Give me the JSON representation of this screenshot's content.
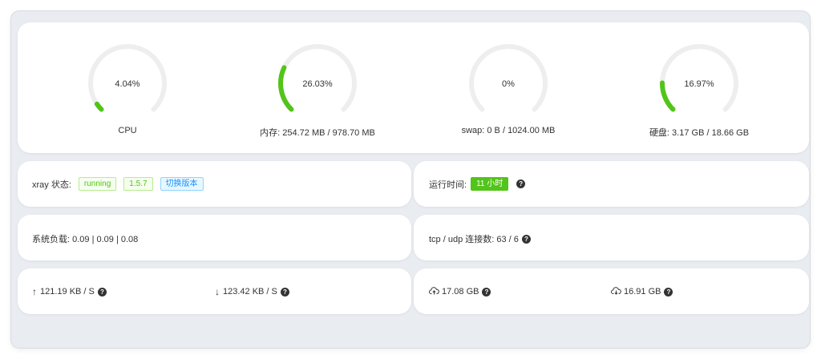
{
  "gauges": [
    {
      "value_text": "4.04%",
      "percent": 4.04,
      "label": "CPU"
    },
    {
      "value_text": "26.03%",
      "percent": 26.03,
      "label": "内存: 254.72 MB / 978.70 MB"
    },
    {
      "value_text": "0%",
      "percent": 0,
      "label": "swap: 0 B / 1024.00 MB"
    },
    {
      "value_text": "16.97%",
      "percent": 16.97,
      "label": "硬盘: 3.17 GB / 18.66 GB"
    }
  ],
  "xray": {
    "label": "xray 状态:",
    "status": "running",
    "version": "1.5.7",
    "switch_label": "切换版本"
  },
  "uptime": {
    "label": "运行时间:",
    "value": "11 小时"
  },
  "load": {
    "text": "系统负载: 0.09 | 0.09 | 0.08"
  },
  "connections": {
    "text": "tcp / udp 连接数: 63 / 6"
  },
  "speed": {
    "up": "121.19 KB / S",
    "down": "123.42 KB / S"
  },
  "traffic": {
    "sent": "17.08 GB",
    "received": "16.91 GB"
  },
  "colors": {
    "accent": "#52c41a",
    "track": "#eeeeee",
    "link": "#1890ff"
  }
}
